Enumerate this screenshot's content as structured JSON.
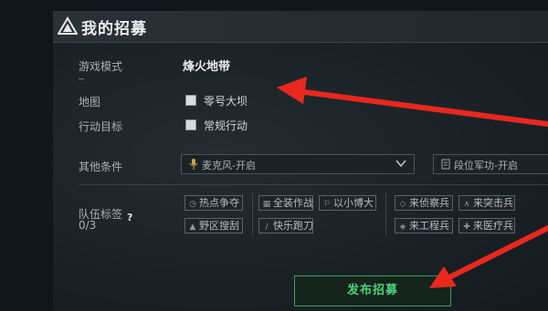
{
  "dialog": {
    "title": "我的招募",
    "title_icon": "triangle-warning-icon"
  },
  "form": {
    "game_mode": {
      "label": "游戏模式",
      "value": "烽火地带"
    },
    "map": {
      "label": "地图",
      "option": "零号大坝",
      "checked": false
    },
    "objective": {
      "label": "行动目标",
      "option": "常规行动",
      "checked": false
    },
    "other_conditions": {
      "label": "其他条件",
      "mic_select": {
        "icon": "microphone-icon",
        "value": "麦克风-开启"
      },
      "rank_select": {
        "icon": "rank-badge-icon",
        "value": "段位军功-开启"
      }
    },
    "team_tags": {
      "label": "队伍标签",
      "count": "0/3",
      "help": "?",
      "tags": [
        {
          "label": "热点争夺",
          "icon": "clock-icon"
        },
        {
          "label": "全装作战",
          "icon": "grid-icon"
        },
        {
          "label": "以小博大",
          "icon": "flag-icon"
        },
        {
          "label": "来侦察兵",
          "icon": "diamond-icon"
        },
        {
          "label": "来突击兵",
          "icon": "chevron-icon"
        },
        {
          "label": "野区搜刮",
          "icon": "bag-icon"
        },
        {
          "label": "快乐跑刀",
          "icon": "knife-icon"
        },
        {
          "label": "来工程兵",
          "icon": "tool-icon"
        },
        {
          "label": "来医疗兵",
          "icon": "cross-icon"
        }
      ]
    }
  },
  "actions": {
    "publish": "发布招募"
  },
  "colors": {
    "accent_green": "#4fd07c",
    "annotation_red": "#e8281e",
    "panel_bg": "#1b2226"
  }
}
